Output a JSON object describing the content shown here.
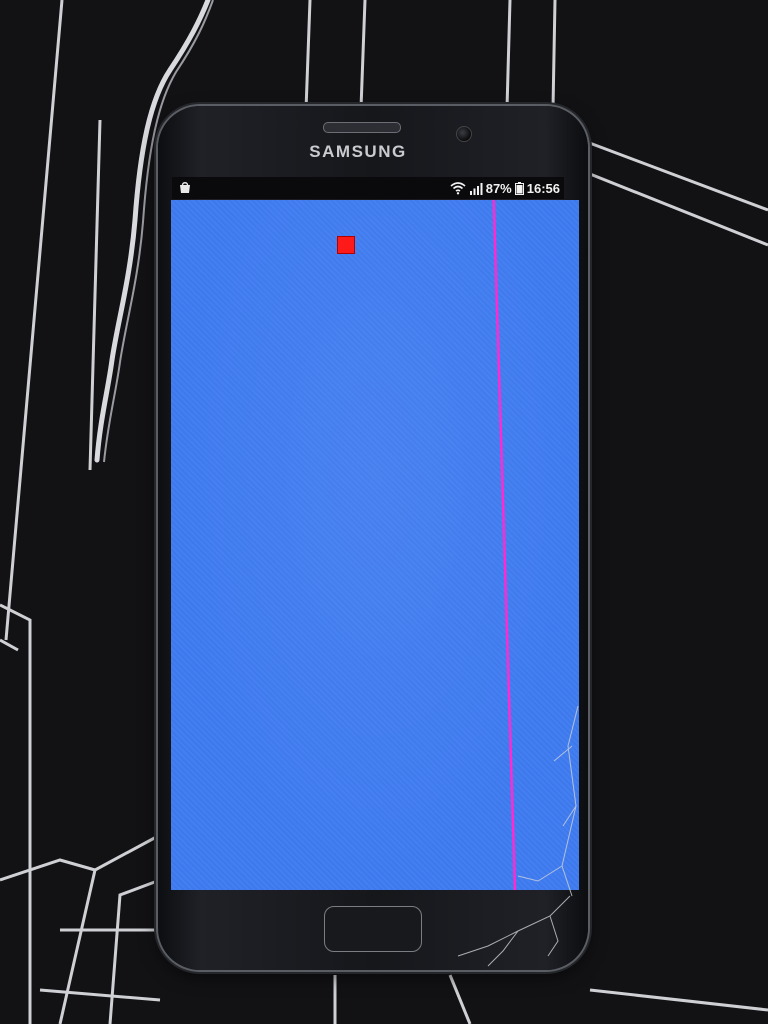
{
  "device": {
    "brand": "SAMSUNG"
  },
  "status_bar": {
    "battery": "87%",
    "time": "16:56",
    "icons": [
      "notification-bag-icon",
      "wifi-icon",
      "signal-icon",
      "battery-icon"
    ]
  },
  "screen": {
    "background_color": "#3f7cf2",
    "marker_color": "#ff1a1a",
    "defect_line_color": "#ff2bd0"
  }
}
